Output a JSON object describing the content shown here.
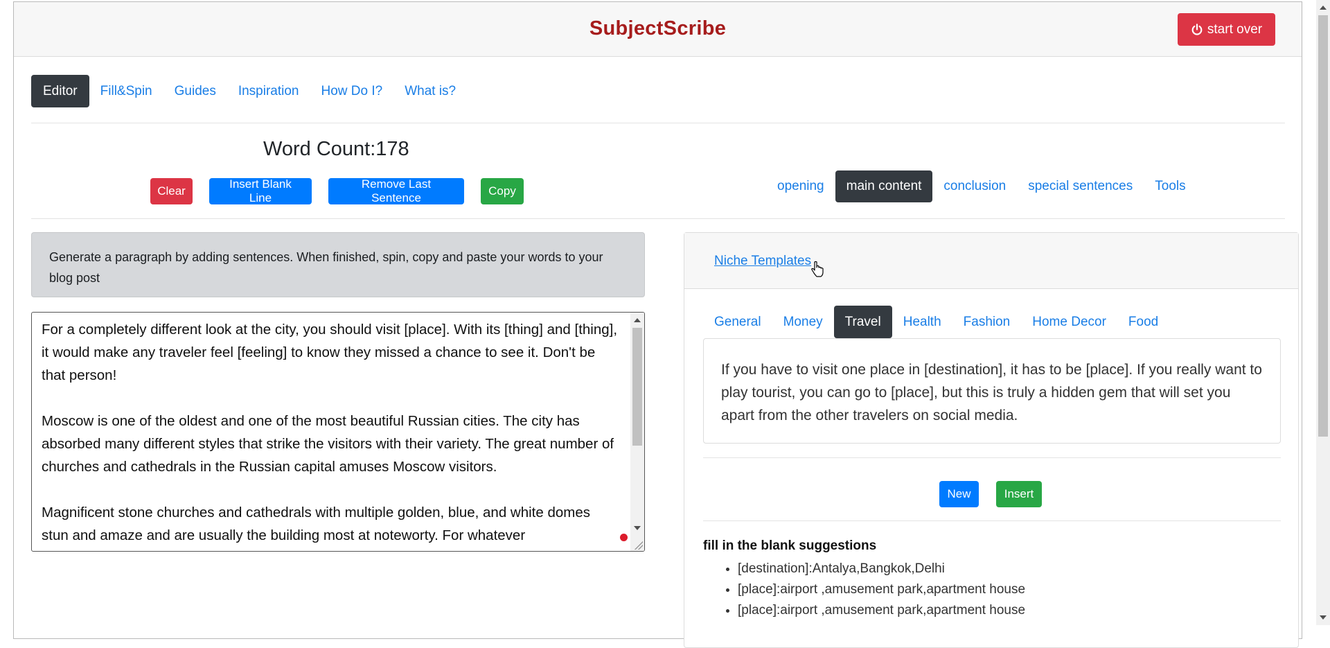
{
  "header": {
    "brand": "SubjectScribe",
    "start_over_label": "start over",
    "start_over_icon": "power-icon"
  },
  "nav": {
    "items": [
      {
        "label": "Editor",
        "active": true
      },
      {
        "label": "Fill&Spin"
      },
      {
        "label": "Guides"
      },
      {
        "label": "Inspiration"
      },
      {
        "label": "How Do I?"
      },
      {
        "label": "What is?"
      }
    ]
  },
  "editor_panel": {
    "word_count": "Word Count:178",
    "buttons": {
      "clear": "Clear",
      "insert_blank_line": "Insert Blank Line",
      "remove_last_sentence": "Remove Last Sentence",
      "copy": "Copy"
    },
    "info": "Generate a paragraph by adding sentences. When finished, spin, copy and paste your words to your blog post",
    "text": "For a completely different look at the city, you should visit [place]. With its [thing] and [thing], it would make any traveler feel [feeling] to know they missed a chance to see it. Don't be that person!\n\nMoscow is one of the oldest and one of the most beautiful Russian cities. The city has absorbed many different styles that strike the visitors with their variety. The great number of churches and cathedrals in the Russian capital amuses Moscow visitors.\n\nMagnificent stone churches and cathedrals with multiple golden, blue, and white domes stun and amaze and are usually the building most at noteworty. For whatever"
  },
  "section_nav": {
    "items": [
      {
        "label": "opening"
      },
      {
        "label": "main content",
        "active": true
      },
      {
        "label": "conclusion"
      },
      {
        "label": "special sentences"
      },
      {
        "label": "Tools"
      }
    ]
  },
  "templates": {
    "header_link": "Niche Templates",
    "tabs": [
      {
        "label": "General"
      },
      {
        "label": "Money"
      },
      {
        "label": "Travel",
        "active": true
      },
      {
        "label": "Health"
      },
      {
        "label": "Fashion"
      },
      {
        "label": "Home Decor"
      },
      {
        "label": "Food"
      }
    ],
    "template_text": "If you have to visit one place in [destination], it has to be [place]. If you really want to play tourist, you can go to [place], but this is truly a hidden gem that will set you apart from the other travelers on social media.",
    "new_label": "New",
    "insert_label": "Insert",
    "suggestions_title": "fill in the blank suggestions",
    "suggestions": [
      "[destination]:Antalya,Bangkok,Delhi",
      "[place]:airport ,amusement park,apartment house",
      "[place]:airport ,amusement park,apartment house"
    ]
  },
  "colors": {
    "brand": "#a61c1c",
    "link": "#1a7ee6",
    "active_tab": "#343a40",
    "danger": "#dc3545",
    "primary": "#007bff",
    "success": "#28a745"
  }
}
